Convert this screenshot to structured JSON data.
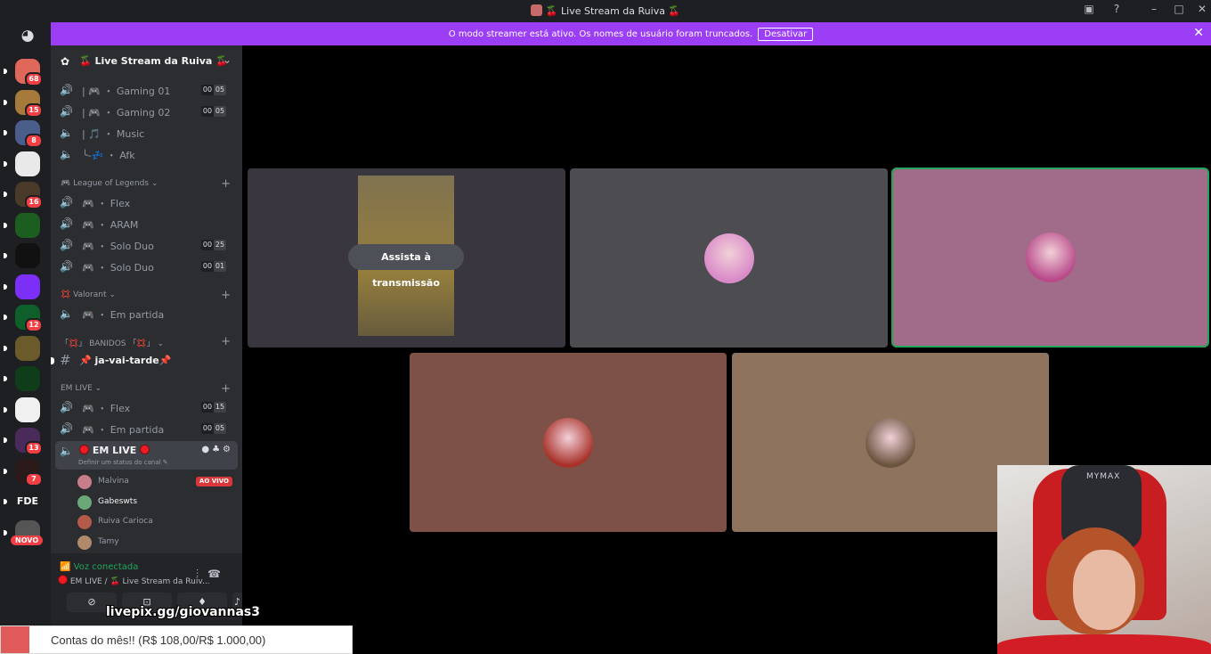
{
  "titlebar": {
    "title": "🍒 Live Stream da Ruiva 🍒",
    "icons": [
      "inbox-icon",
      "help-icon",
      "minimize-icon",
      "maximize-icon",
      "close-icon"
    ]
  },
  "banner": {
    "text": "O modo streamer está ativo. Os nomes de usuário foram truncados.",
    "button": "Desativar"
  },
  "rail": {
    "servers": [
      {
        "badge": "68",
        "color": "#e0685a"
      },
      {
        "badge": "15",
        "color": "#a57a3a"
      },
      {
        "badge": "8",
        "color": "#4b5d8a"
      },
      {
        "badge": "",
        "color": "#e9e9e9"
      },
      {
        "badge": "16",
        "color": "#4a3a2a"
      },
      {
        "badge": "",
        "color": "#1b5e20"
      },
      {
        "badge": "",
        "color": "#111111"
      },
      {
        "badge": "",
        "color": "#7b2ff7"
      },
      {
        "badge": "12",
        "color": "#0e5f2a"
      },
      {
        "badge": "",
        "color": "#6b5a2a"
      },
      {
        "badge": "",
        "color": "#0f3d1a"
      },
      {
        "badge": "",
        "color": "#f0f0f0"
      },
      {
        "badge": "13",
        "color": "#4a2a5a"
      },
      {
        "badge": "7",
        "color": "#2a1a1a"
      },
      {
        "badge": "",
        "color": "#1e1f22",
        "text": "FDE"
      },
      {
        "badge": "",
        "color": "#555555"
      }
    ],
    "novo_label": "NOVO"
  },
  "guild": {
    "name": "🍒 Live Stream da Ruiva 🍒"
  },
  "channels": {
    "top": [
      {
        "name": "| 🎮 ・ Gaming 01",
        "count_a": "00",
        "count_b": "05"
      },
      {
        "name": "| 🎮 ・ Gaming 02",
        "count_a": "00",
        "count_b": "05"
      },
      {
        "name": "| 🎵 ・ Music"
      },
      {
        "name": "╰-💤 ・ Afk"
      }
    ],
    "lol_category": "🎮 League of Legends ⌄",
    "lol": [
      {
        "name": "🎮 ・ Flex"
      },
      {
        "name": "🎮 ・ ARAM"
      },
      {
        "name": "🎮 ・ Solo Duo",
        "count_a": "00",
        "count_b": "25"
      },
      {
        "name": "🎮 ・ Solo Duo",
        "count_a": "00",
        "count_b": "01"
      }
    ],
    "valorant_category": "💢 Valorant ⌄",
    "valorant": [
      {
        "name": "🎮 ・ Em partida"
      }
    ],
    "banidos_category": "「💢」 BANIDOS 「💢」 ⌄",
    "text_channel": "📌 ja-vai-tarde📌",
    "emlive_category": "EM LIVE ⌄",
    "emlive": [
      {
        "name": "🎮 ・ Flex",
        "count_a": "00",
        "count_b": "15"
      },
      {
        "name": "🎮 ・ Em partida",
        "count_a": "00",
        "count_b": "05"
      }
    ],
    "active": {
      "name": "EM LIVE",
      "status": "Definir um status do canal ✎"
    },
    "voice_users": [
      {
        "name": "Malvina",
        "live": "AO VIVO",
        "color": "#c77d8a"
      },
      {
        "name": "Gabeswts",
        "live": "",
        "color": "#6aa87a"
      },
      {
        "name": "Ruiva Carioca",
        "live": "",
        "color": "#b35a4a"
      },
      {
        "name": "Tamy",
        "live": "",
        "color": "#b08a6a"
      }
    ]
  },
  "voice_panel": {
    "status": "Voz conectada",
    "location": "EM LIVE / 🍒 Live Stream da Ruiv...",
    "buttons": [
      "camera-off-icon",
      "screen-share-icon",
      "activity-icon",
      "soundboard-icon"
    ]
  },
  "stage": {
    "watch_label": "Assista à transmissão",
    "tiles": [
      {
        "bg": "#3a3640",
        "avatar": "#c78ad6"
      },
      {
        "bg": "#4d4c51",
        "avatar": "#d98ac8"
      },
      {
        "bg": "#a16c8a",
        "avatar": "#b84a8a",
        "speaking": true
      },
      {
        "bg": "#7d5147",
        "avatar": "#a8322a"
      },
      {
        "bg": "#8e735e",
        "avatar": "#6b5540"
      }
    ]
  },
  "overlay": {
    "livepix": "livepix.gg/giovannas3",
    "goal_text": "Contas do mês!! (R$ 108,00/R$ 1.000,00)",
    "goal_progress": 0.108,
    "webcam_brand": "MYMAX"
  }
}
